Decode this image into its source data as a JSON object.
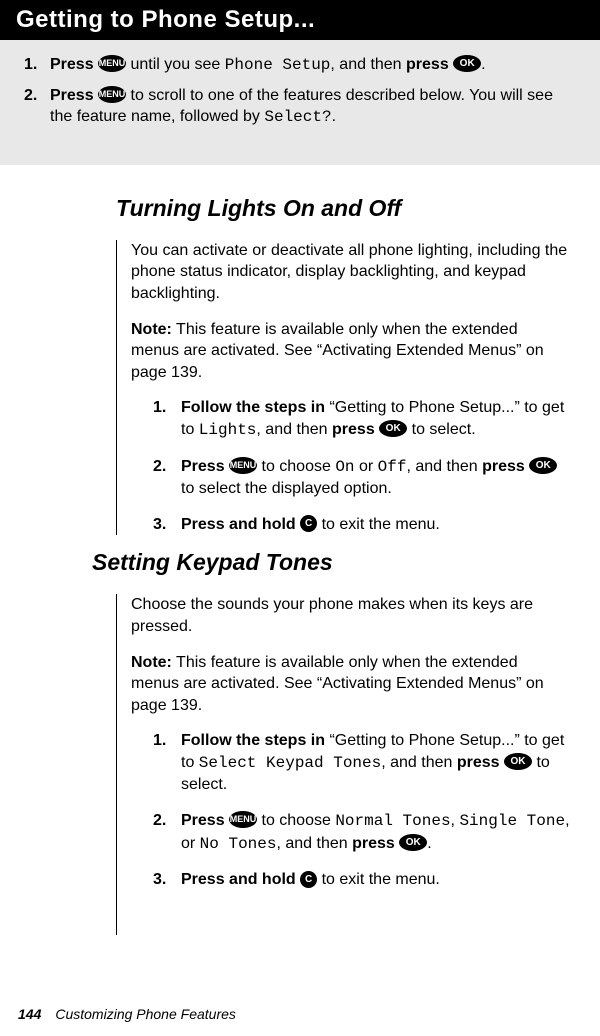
{
  "heading_bar": "Getting to Phone Setup...",
  "grey_steps": {
    "s1": {
      "num": "1.",
      "press1": "Press ",
      "mid1": " until you see ",
      "lcd1": "Phone Setup",
      "mid2": ", and then ",
      "press2": "press ",
      "end": "."
    },
    "s2": {
      "num": "2.",
      "press1": "Press ",
      "mid1": " to scroll to one of the features described below. You will see the feature name, followed by ",
      "lcd1": "Select?",
      "end": "."
    }
  },
  "section1": {
    "title": "Turning Lights On and Off",
    "para1": "You can activate or deactivate all phone lighting, including the phone status indicator, display backlighting, and keypad backlighting.",
    "note_label": "Note:",
    "note_text": " This feature is available only when the extended menus are activated. See “Activating Extended Menus” on page 139.",
    "steps": {
      "s1": {
        "num": "1.",
        "bold1": "Follow the steps in ",
        "plain1": "“Getting to Phone Setup...” to get to ",
        "lcd1": "Lights",
        "plain2": ", and then ",
        "bold2": "press ",
        "plain3": " to select."
      },
      "s2": {
        "num": "2.",
        "bold1": "Press ",
        "plain1": " to choose ",
        "lcd1": "On",
        "plain2": " or ",
        "lcd2": "Off",
        "plain3": ", and then ",
        "bold2": "press ",
        "plain4": " to select the displayed option."
      },
      "s3": {
        "num": "3.",
        "bold1": "Press and hold ",
        "plain1": " to exit the menu."
      }
    }
  },
  "section2": {
    "title": "Setting Keypad Tones",
    "para1": "Choose the sounds your phone makes when its keys are pressed.",
    "note_label": "Note:",
    "note_text": " This feature is available only when the extended menus are activated. See “Activating Extended Menus” on page 139.",
    "steps": {
      "s1": {
        "num": "1.",
        "bold1": "Follow the steps in ",
        "plain1": "“Getting to Phone Setup...” to get to ",
        "lcd1": "Select Keypad Tones",
        "plain2": ", and then ",
        "bold2": "press ",
        "plain3": " to select."
      },
      "s2": {
        "num": "2.",
        "bold1": "Press ",
        "plain1": " to choose ",
        "lcd1": "Normal Tones",
        "comma1": ", ",
        "lcd2": "Single Tone",
        "plain2": ", or ",
        "lcd3": "No Tones",
        "plain3": ", and then ",
        "bold2": "press ",
        "end": "."
      },
      "s3": {
        "num": "3.",
        "bold1": "Press and hold ",
        "plain1": " to exit the menu."
      }
    }
  },
  "footer": {
    "page": "144",
    "title": "Customizing Phone Features"
  },
  "icons": {
    "menu": "MENU",
    "ok": "OK",
    "c": "C"
  }
}
